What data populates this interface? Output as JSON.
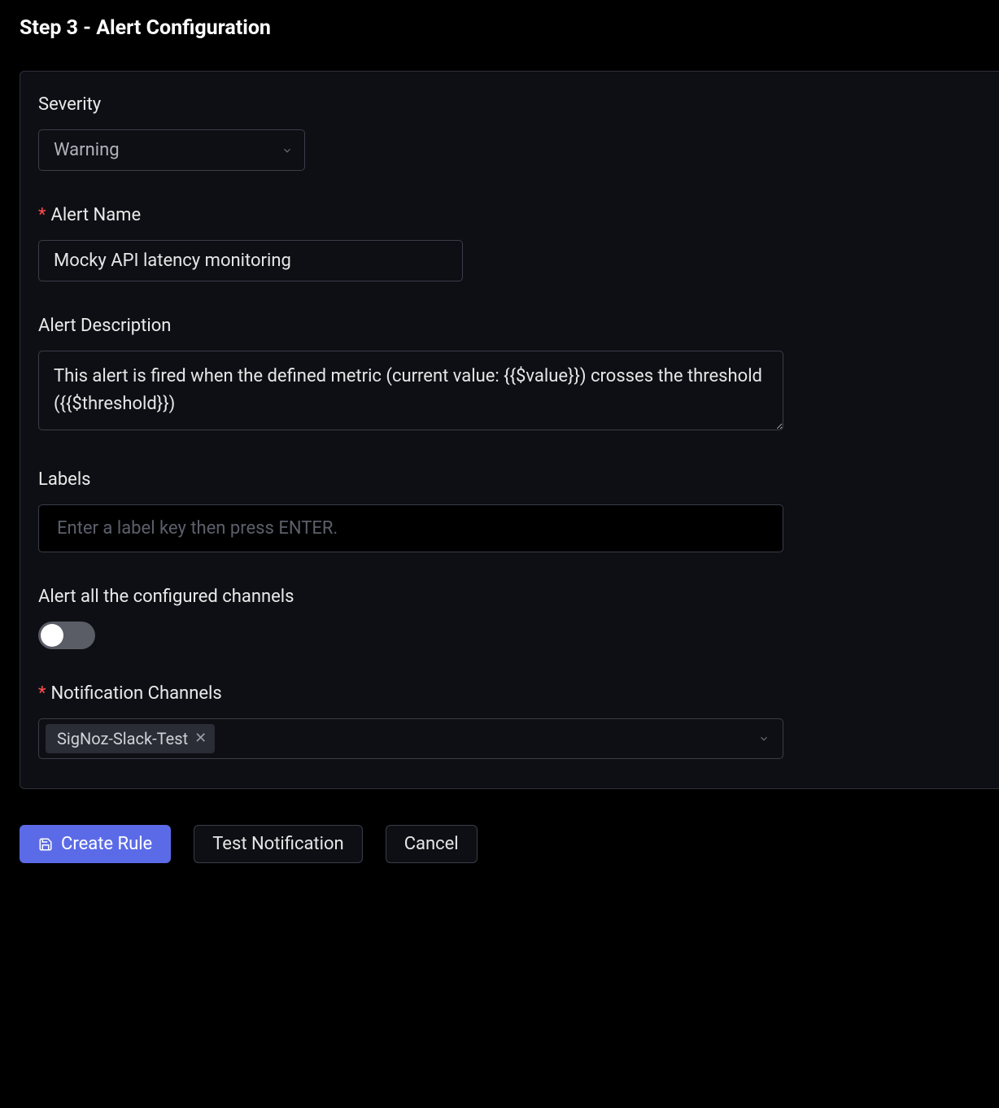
{
  "step": {
    "title": "Step 3 - Alert Configuration"
  },
  "severity": {
    "label": "Severity",
    "value": "Warning"
  },
  "alertName": {
    "label": "Alert Name",
    "value": "Mocky API latency monitoring"
  },
  "alertDescription": {
    "label": "Alert Description",
    "value": "This alert is fired when the defined metric (current value: {{$value}}) crosses the threshold ({{$threshold}})"
  },
  "labels": {
    "label": "Labels",
    "placeholder": "Enter a label key then press ENTER."
  },
  "alertAllChannels": {
    "label": "Alert all the configured channels",
    "value": false
  },
  "notificationChannels": {
    "label": "Notification Channels",
    "tags": [
      "SigNoz-Slack-Test"
    ]
  },
  "buttons": {
    "createRule": "Create Rule",
    "testNotification": "Test Notification",
    "cancel": "Cancel"
  }
}
